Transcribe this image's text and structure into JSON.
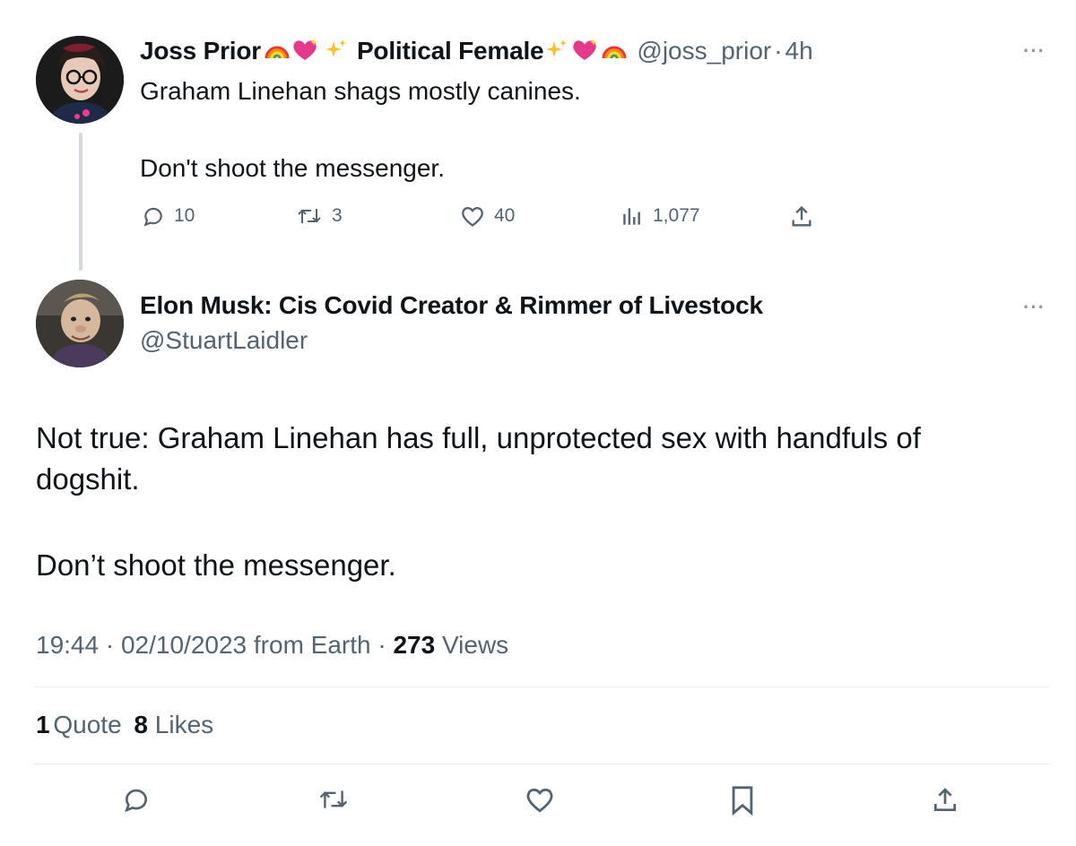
{
  "reply_to": {
    "name_part1": "Joss Prior",
    "name_part2": "Political Female",
    "handle": "@joss_prior",
    "separator": "·",
    "time": "4h",
    "text_line1": "Graham Linehan shags mostly canines.",
    "text_line2": "Don't shoot the messenger.",
    "metrics": {
      "replies": "10",
      "reposts": "3",
      "likes": "40",
      "views": "1,077"
    },
    "emoji": [
      "rainbow",
      "sparkling-heart",
      "sparkles",
      "sparkles",
      "sparkling-heart",
      "rainbow"
    ]
  },
  "main_tweet": {
    "name": "Elon Musk: Cis Covid Creator & Rimmer of Livestock",
    "handle": "@StuartLaidler",
    "text_line1": "Not true: Graham Linehan has full, unprotected sex with handfuls of",
    "text_line2": "dogshit.",
    "text_line3": "Don’t shoot the messenger.",
    "time": "19:44",
    "separator": "·",
    "date": "02/10/2023",
    "source": "from Earth",
    "views_count": "273",
    "views_label": "Views",
    "quotes_count": "1",
    "quotes_label": "Quote",
    "likes_count": "8",
    "likes_label": "Likes"
  },
  "icons": {
    "more": "more-icon",
    "reply": "reply-icon",
    "repost": "repost-icon",
    "like": "like-icon",
    "views": "views-icon",
    "share": "share-icon",
    "bookmark": "bookmark-icon"
  },
  "colors": {
    "text": "#0f1419",
    "muted": "#536471",
    "divider": "#e6ecf0",
    "thread_line": "#cfd9de"
  }
}
